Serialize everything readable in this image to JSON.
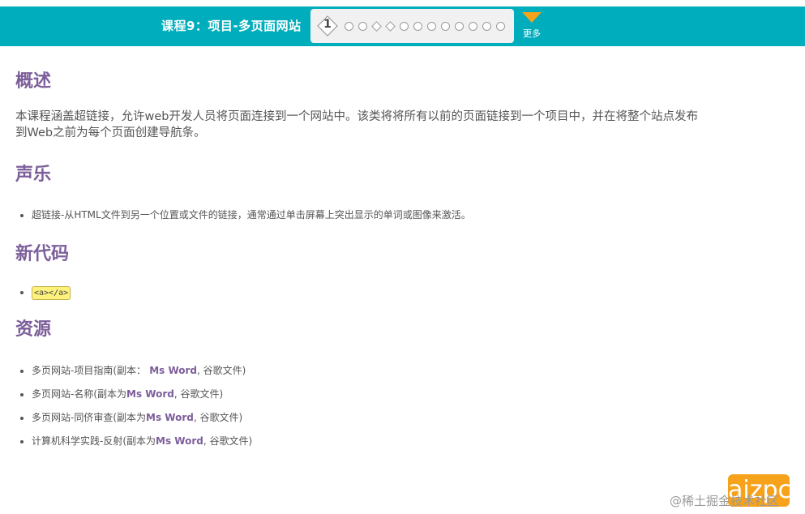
{
  "header": {
    "lesson_title": "课程9：项目-多页面网站",
    "current_step": "1",
    "steps": [
      "circle",
      "circle",
      "diamond",
      "diamond",
      "circle",
      "circle",
      "circle",
      "circle",
      "circle",
      "circle",
      "circle",
      "circle"
    ],
    "more_label": "更多",
    "colors": {
      "bar": "#00adbc",
      "more_arrow": "#f7a21b"
    }
  },
  "sections": {
    "overview": {
      "heading": "概述",
      "text_line1": "本课程涵盖超链接，允许web开发人员将页面连接到一个网站中。该类将将所有以前的页面链接到一个项目中，并在将整个站点发布",
      "text_line2": "到Web之前为每个页面创建导航条。"
    },
    "vocab": {
      "heading": "声乐",
      "items": [
        "超链接-从HTML文件到另一个位置或文件的链接，通常通过单击屏幕上突出显示的单词或图像来激活。"
      ]
    },
    "new_code": {
      "heading": "新代码",
      "code": "<a></a>"
    },
    "resources": {
      "heading": "资源",
      "items": [
        {
          "prefix": "多页网站-项目指南(副本：",
          "link": " Ms Word",
          "suffix": ", 谷歌文件)"
        },
        {
          "prefix": "多页网站-名称(副本为",
          "link": "Ms Word",
          "suffix": ", 谷歌文件)"
        },
        {
          "prefix": "多页网站-同侪审查(副本为",
          "link": "Ms Word",
          "suffix": ", 谷歌文件)"
        },
        {
          "prefix": "计算机科学实践-反射(副本为",
          "link": "Ms Word",
          "suffix": ", 谷歌文件)"
        }
      ]
    }
  },
  "overlay": {
    "badge_text": "aizpc",
    "watermark": "@稀土掘金技术社区"
  }
}
